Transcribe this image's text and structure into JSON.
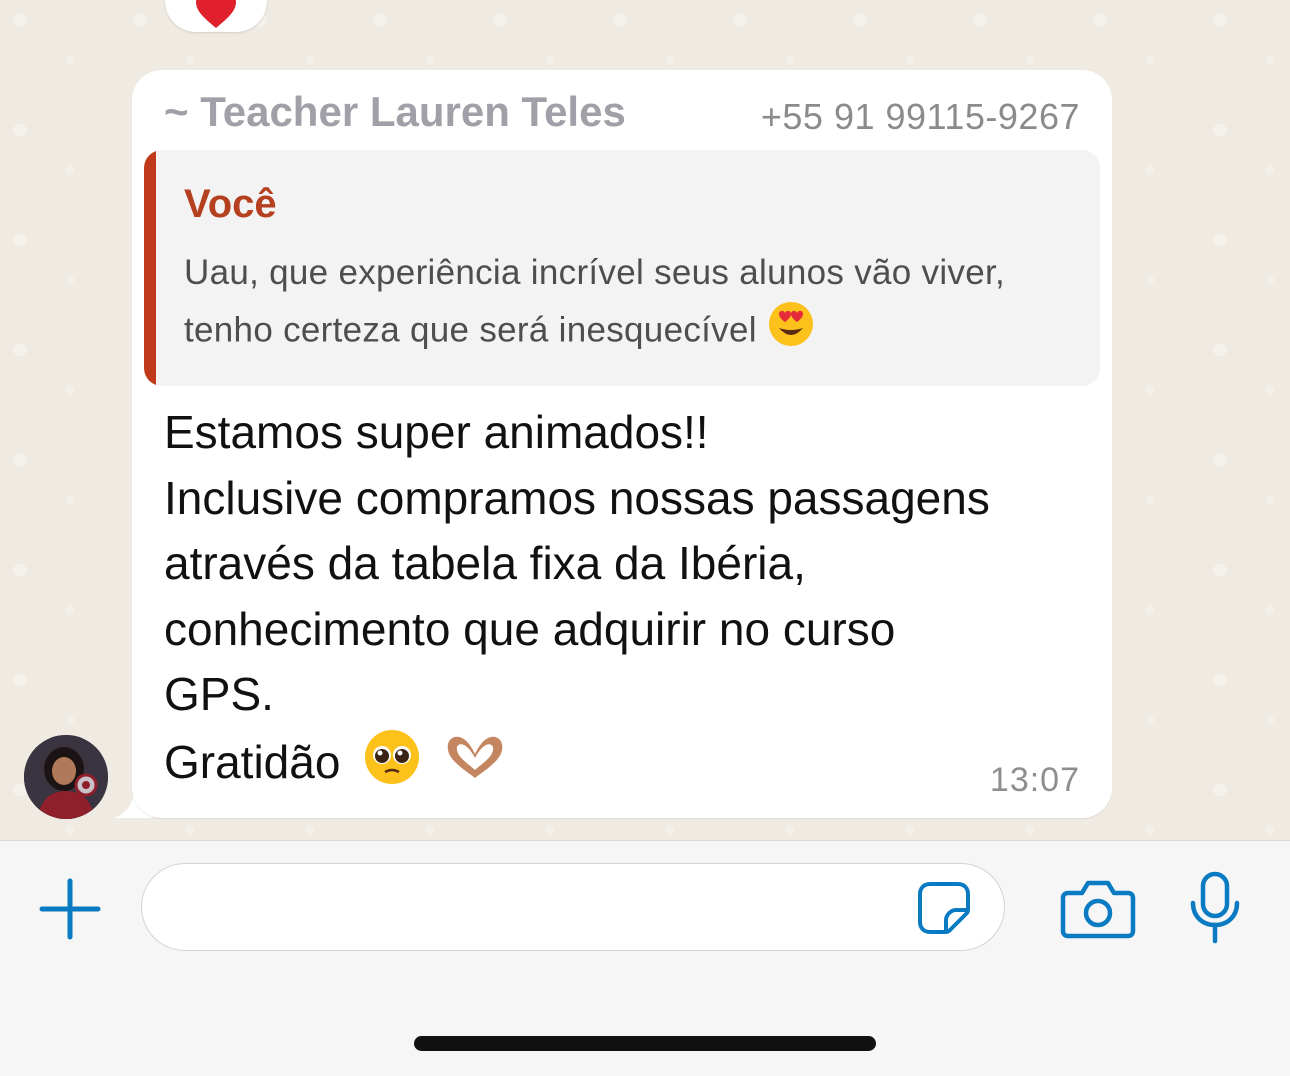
{
  "message": {
    "sender_name": "~ Teacher Lauren Teles",
    "sender_phone": "+55 91 99115-9267",
    "quoted": {
      "author": "Você",
      "text": "Uau, que experiência incrível seus alunos vão viver, tenho certeza que será inesquecível"
    },
    "lines": [
      "Estamos super animados!!",
      "Inclusive compramos nossas passagens",
      "através da tabela fixa da Ibéria,",
      "conhecimento que adquirir no curso",
      "GPS.",
      "Gratidão"
    ],
    "time": "13:07",
    "icons": [
      "heart-eyes-emoji",
      "pleading-face-emoji",
      "heart-hands-emoji"
    ]
  },
  "reaction": {
    "icon": "red-heart-emoji"
  },
  "composer": {
    "input_value": "",
    "icons": [
      "plus-icon",
      "sticker-icon",
      "camera-icon",
      "microphone-icon"
    ]
  },
  "colors": {
    "accent": "#0a7bc2",
    "quote_bar": "#c0391b",
    "quote_author": "#b5401f",
    "sender_name": "#a39fa8"
  }
}
